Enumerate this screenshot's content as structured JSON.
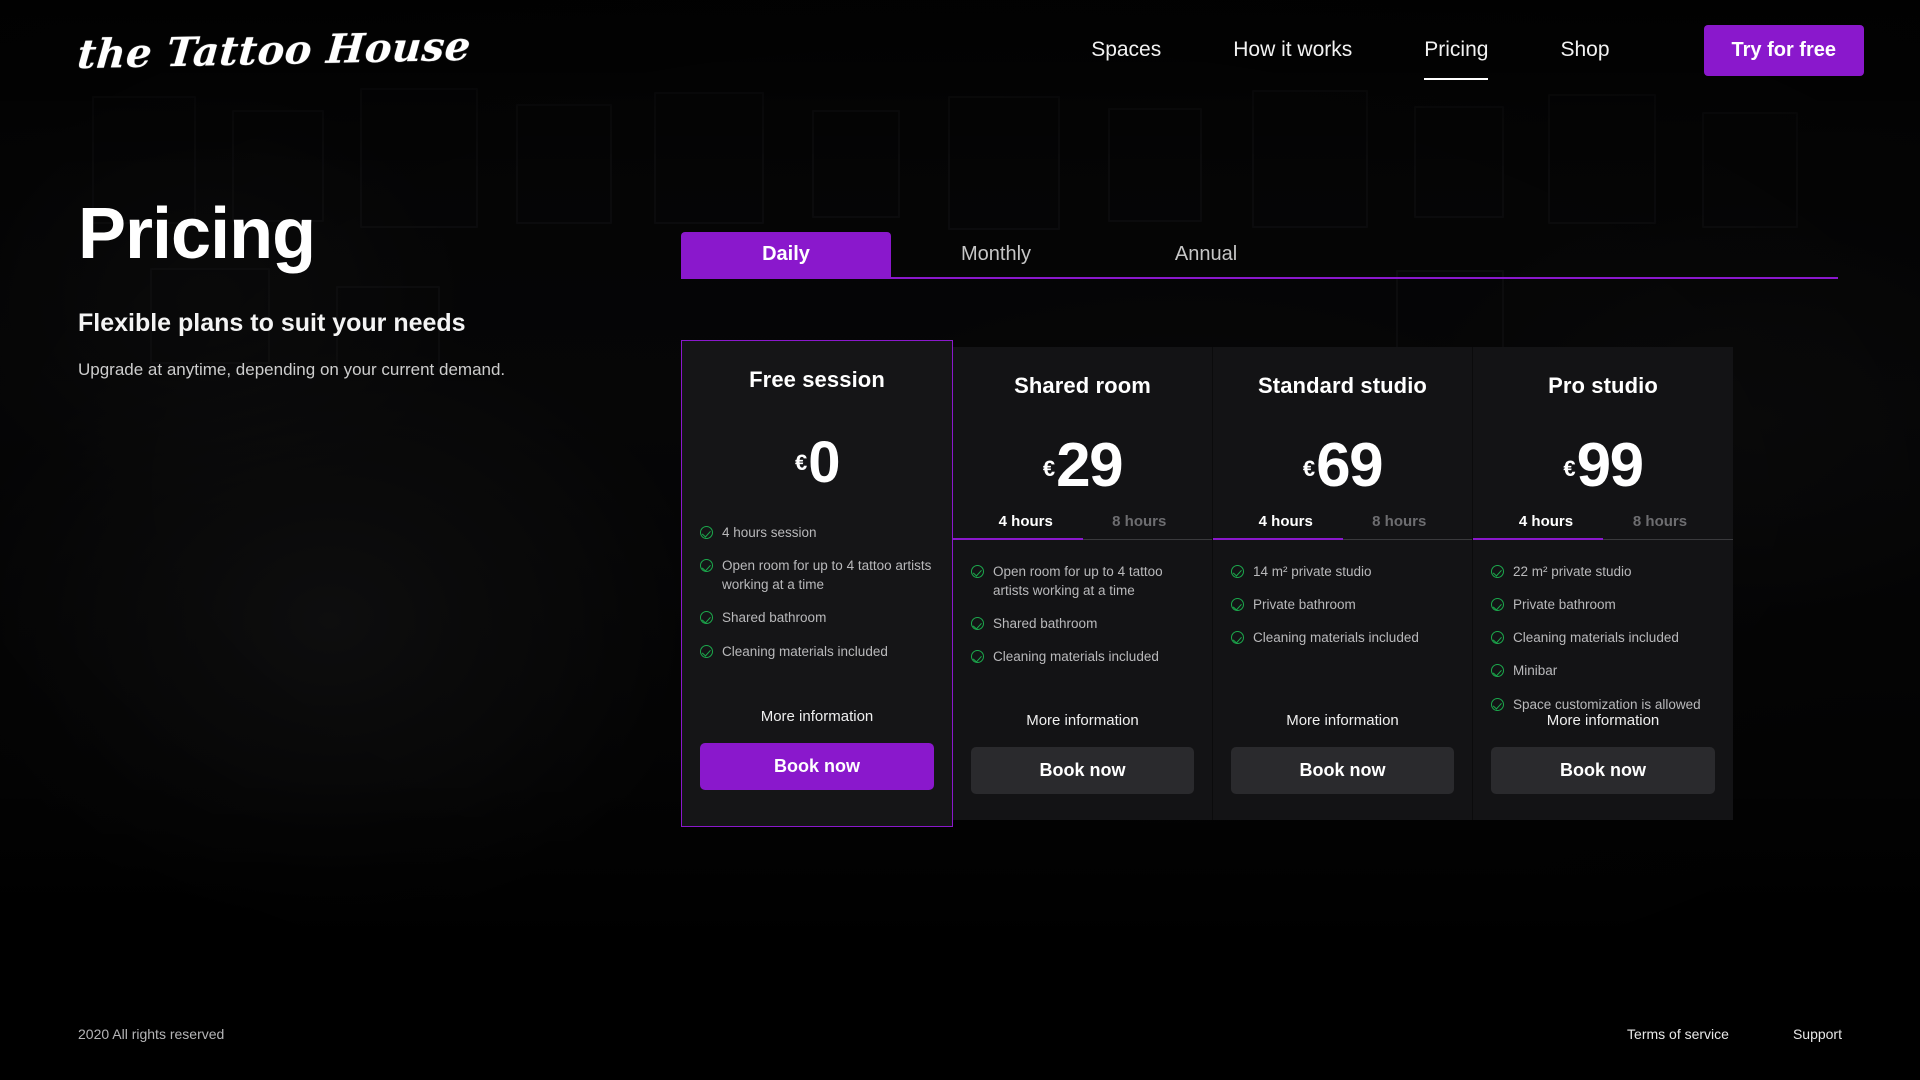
{
  "brand": {
    "logo_text": "the Tattoo House"
  },
  "nav": {
    "items": [
      {
        "label": "Spaces",
        "active": false
      },
      {
        "label": "How it works",
        "active": false
      },
      {
        "label": "Pricing",
        "active": true
      },
      {
        "label": "Shop",
        "active": false
      }
    ],
    "cta_label": "Try for free"
  },
  "intro": {
    "title": "Pricing",
    "subtitle": "Flexible plans to suit your needs",
    "lead": "Upgrade at anytime, depending on your current demand."
  },
  "period_tabs": {
    "items": [
      {
        "label": "Daily",
        "active": true
      },
      {
        "label": "Monthly",
        "active": false
      },
      {
        "label": "Annual",
        "active": false
      }
    ]
  },
  "hour_options": {
    "selected": "4 hours",
    "other": "8 hours"
  },
  "labels": {
    "more_information": "More information",
    "book_now": "Book now"
  },
  "plans": [
    {
      "name": "Free session",
      "currency": "€",
      "amount": "0",
      "has_hours": false,
      "featured": true,
      "features": [
        "4 hours session",
        "Open room for up to 4 tattoo artists working at a time",
        "Shared bathroom",
        "Cleaning materials included"
      ]
    },
    {
      "name": "Shared room",
      "currency": "€",
      "amount": "29",
      "has_hours": true,
      "featured": false,
      "features": [
        "Open room for up to 4 tattoo artists working at a time",
        "Shared bathroom",
        "Cleaning materials included"
      ]
    },
    {
      "name": "Standard studio",
      "currency": "€",
      "amount": "69",
      "has_hours": true,
      "featured": false,
      "features": [
        "14 m² private studio",
        "Private bathroom",
        "Cleaning materials included"
      ]
    },
    {
      "name": "Pro studio",
      "currency": "€",
      "amount": "99",
      "has_hours": true,
      "featured": false,
      "features": [
        "22 m² private studio",
        "Private bathroom",
        "Cleaning materials included",
        "Minibar",
        "Space customization is allowed"
      ]
    }
  ],
  "footer": {
    "copyright": "2020 All rights reserved",
    "links": [
      "Terms of service",
      "Support"
    ]
  },
  "colors": {
    "accent_purple": "#8A18CC",
    "check_green": "#1CA84C",
    "card_bg": "#131315",
    "page_bg": "#050505"
  }
}
